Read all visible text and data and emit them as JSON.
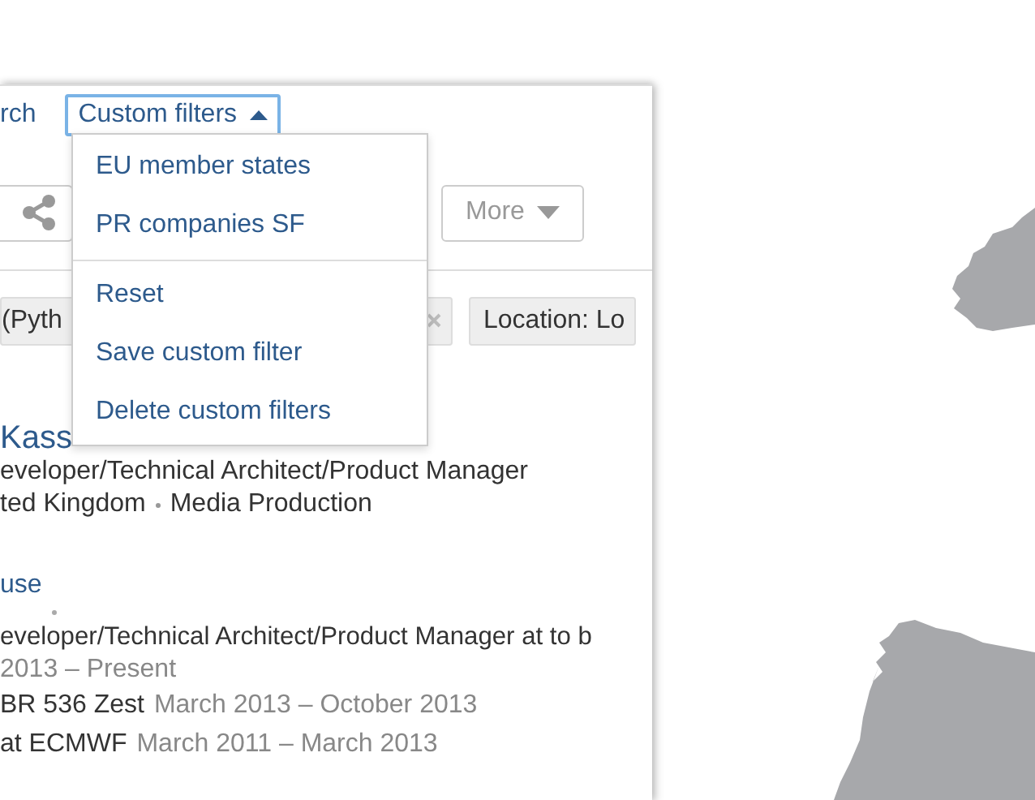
{
  "search_bar": {
    "tab": "rch",
    "custom_filters_button": {
      "label": "Custom filters",
      "expanded": true
    }
  },
  "menu": {
    "saved_filters": [
      {
        "label": "EU member states"
      },
      {
        "label": "PR companies SF"
      }
    ],
    "actions": [
      {
        "label": "Reset"
      },
      {
        "label": "Save custom filter"
      },
      {
        "label": "Delete custom filters"
      }
    ]
  },
  "toolbar": {
    "more_button": "More"
  },
  "filter_chips": [
    {
      "label": "(Pyth",
      "removable": true
    },
    {
      "label": "Location: Lo",
      "removable": false
    }
  ],
  "result": {
    "name": "Kass",
    "headline": "eveloper/Technical Architect/Product Manager",
    "location": "ted Kingdom",
    "industry": "Media Production",
    "company_link": "use",
    "current_position": "eveloper/Technical Architect/Product Manager at to b",
    "current_dates": "2013 – Present",
    "past_positions": [
      {
        "title": "BR 536 Zest",
        "dates": "March 2013 – October 2013"
      },
      {
        "title": "at ECMWF",
        "dates": "March 2011 – March 2013"
      }
    ]
  }
}
